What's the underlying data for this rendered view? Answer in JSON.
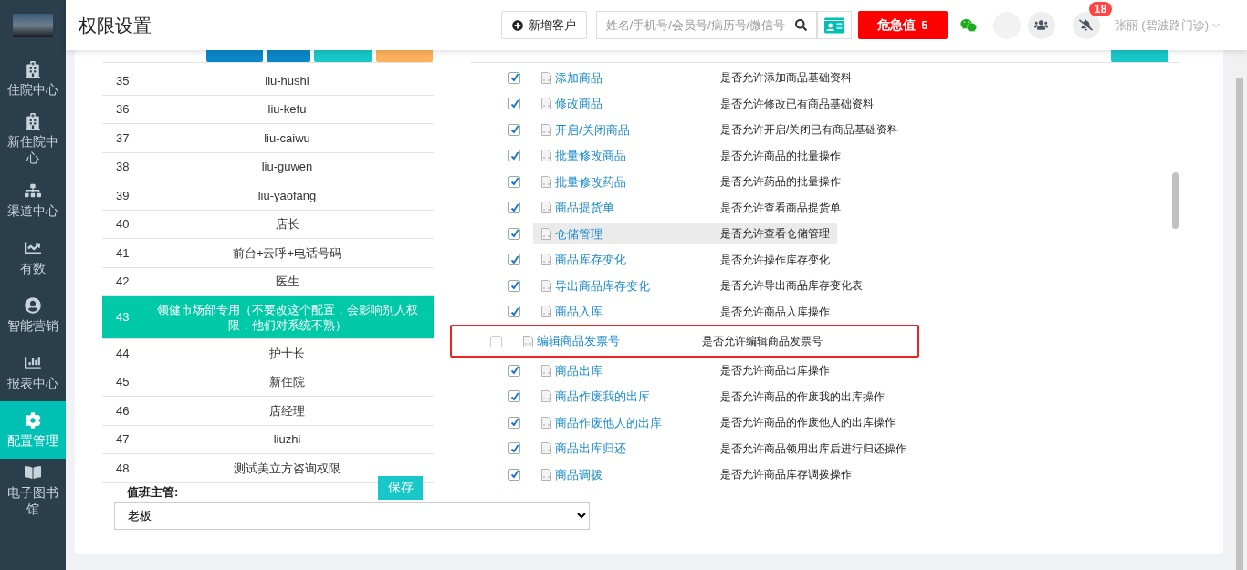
{
  "sidebar": {
    "items": [
      {
        "label": "住院中心",
        "selected": false
      },
      {
        "label": "新住院中心",
        "selected": false
      },
      {
        "label": "渠道中心",
        "selected": false
      },
      {
        "label": "有数",
        "selected": false
      },
      {
        "label": "智能营销",
        "selected": false
      },
      {
        "label": "报表中心",
        "selected": false
      },
      {
        "label": "配置管理",
        "selected": true
      },
      {
        "label": "电子图书馆",
        "selected": false
      }
    ]
  },
  "header": {
    "title": "权限设置",
    "add_customer": "新增客户",
    "search": {
      "placeholder": "姓名/手机号/会员号/病历号/微信号"
    },
    "alert": {
      "label": "危急值",
      "count": "5"
    },
    "notification_badge": "18",
    "user": "张丽 (碧波路门诊)"
  },
  "roles": {
    "rows": [
      {
        "id": "35",
        "name": "liu-hushi",
        "selected": false
      },
      {
        "id": "36",
        "name": "liu-kefu",
        "selected": false
      },
      {
        "id": "37",
        "name": "liu-caiwu",
        "selected": false
      },
      {
        "id": "38",
        "name": "liu-guwen",
        "selected": false
      },
      {
        "id": "39",
        "name": "liu-yaofang",
        "selected": false
      },
      {
        "id": "40",
        "name": "店长",
        "selected": false
      },
      {
        "id": "41",
        "name": "前台+云呼+电话号码",
        "selected": false
      },
      {
        "id": "42",
        "name": "医生",
        "selected": false
      },
      {
        "id": "43",
        "name": "领健市场部专用（不要改这个配置，会影响别人权限，他们对系统不熟）",
        "selected": true
      },
      {
        "id": "44",
        "name": "护士长",
        "selected": false
      },
      {
        "id": "45",
        "name": "新住院",
        "selected": false
      },
      {
        "id": "46",
        "name": "店经理",
        "selected": false
      },
      {
        "id": "47",
        "name": "liuzhi",
        "selected": false
      },
      {
        "id": "48",
        "name": "测试美立方咨询权限",
        "selected": false
      }
    ],
    "supervisor_label": "值班主管:",
    "save": "保存",
    "supervisor_value": "老板"
  },
  "permissions": [
    {
      "name": "添加商品",
      "desc": "是否允许添加商品基础资料",
      "checked": true,
      "hovered": false,
      "outlined": false
    },
    {
      "name": "修改商品",
      "desc": "是否允许修改已有商品基础资料",
      "checked": true,
      "hovered": false,
      "outlined": false
    },
    {
      "name": "开启/关闭商品",
      "desc": "是否允许开启/关闭已有商品基础资料",
      "checked": true,
      "hovered": false,
      "outlined": false
    },
    {
      "name": "批量修改商品",
      "desc": "是否允许商品的批量操作",
      "checked": true,
      "hovered": false,
      "outlined": false
    },
    {
      "name": "批量修改药品",
      "desc": "是否允许药品的批量操作",
      "checked": true,
      "hovered": false,
      "outlined": false
    },
    {
      "name": "商品提货单",
      "desc": "是否允许查看商品提货单",
      "checked": true,
      "hovered": false,
      "outlined": false
    },
    {
      "name": "仓储管理",
      "desc": "是否允许查看仓储管理",
      "checked": true,
      "hovered": true,
      "outlined": false
    },
    {
      "name": "商品库存变化",
      "desc": "是否允许操作库存变化",
      "checked": true,
      "hovered": false,
      "outlined": false
    },
    {
      "name": "导出商品库存变化",
      "desc": "是否允许导出商品库存变化表",
      "checked": true,
      "hovered": false,
      "outlined": false
    },
    {
      "name": "商品入库",
      "desc": "是否允许商品入库操作",
      "checked": true,
      "hovered": false,
      "outlined": false
    },
    {
      "name": "编辑商品发票号",
      "desc": "是否允许编辑商品发票号",
      "checked": false,
      "hovered": false,
      "outlined": true
    },
    {
      "name": "商品出库",
      "desc": "是否允许商品出库操作",
      "checked": true,
      "hovered": false,
      "outlined": false
    },
    {
      "name": "商品作废我的出库",
      "desc": "是否允许商品的作废我的出库操作",
      "checked": true,
      "hovered": false,
      "outlined": false
    },
    {
      "name": "商品作废他人的出库",
      "desc": "是否允许商品的作废他人的出库操作",
      "checked": true,
      "hovered": false,
      "outlined": false
    },
    {
      "name": "商品出库归还",
      "desc": "是否允许商品领用出库后进行归还操作",
      "checked": true,
      "hovered": false,
      "outlined": false
    },
    {
      "name": "商品调拨",
      "desc": "是否允许商品库存调拨操作",
      "checked": true,
      "hovered": false,
      "outlined": false
    }
  ]
}
